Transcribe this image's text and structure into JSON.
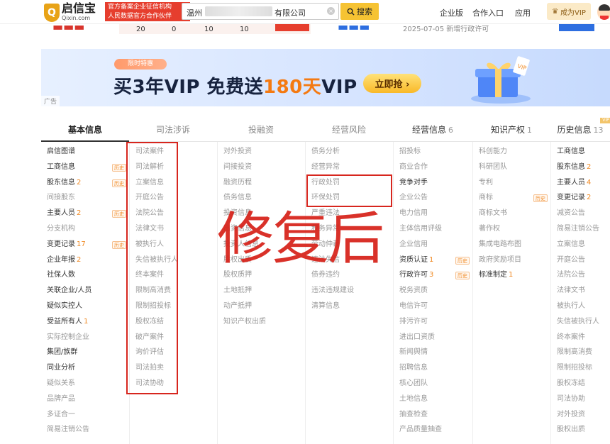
{
  "header": {
    "logo_cn": "启信宝",
    "logo_en": "Qixin.com",
    "badge_line1": "官方备案企业征信机构",
    "badge_line2": "人民数据官方合作伙伴",
    "search_value": "温州",
    "search_value_suffix": "有限公司",
    "search_button": "搜索",
    "nav": [
      "企业版",
      "合作入口",
      "应用"
    ],
    "vip_button": "成为VIP"
  },
  "strip": {
    "numbers": [
      "20",
      "0",
      "10",
      "10"
    ],
    "date": "2025-07-05 新增行政许可"
  },
  "banner": {
    "tag": "限时特惠",
    "text_a": "买3年VIP  免费送",
    "text_hl": "180天",
    "text_b": "VIP",
    "button": "立即抢 ›",
    "ad": "广告"
  },
  "tabs": [
    {
      "label": "基本信息",
      "count": ""
    },
    {
      "label": "司法涉诉",
      "count": ""
    },
    {
      "label": "投融资",
      "count": ""
    },
    {
      "label": "经营风险",
      "count": ""
    },
    {
      "label": "经营信息",
      "count": "6"
    },
    {
      "label": "知识产权",
      "count": "1"
    },
    {
      "label": "历史信息",
      "count": "13"
    }
  ],
  "vip_corner": "VIP",
  "history_tag": "历史",
  "columns": [
    [
      {
        "t": "启信图谱",
        "n": "",
        "h": false,
        "d": true
      },
      {
        "t": "工商信息",
        "n": "",
        "h": true,
        "d": true
      },
      {
        "t": "股东信息",
        "n": "2",
        "h": true,
        "d": true
      },
      {
        "t": "间接股东",
        "n": "",
        "h": false,
        "d": false
      },
      {
        "t": "主要人员",
        "n": "2",
        "h": true,
        "d": true
      },
      {
        "t": "分支机构",
        "n": "",
        "h": false,
        "d": false
      },
      {
        "t": "变更记录",
        "n": "17",
        "h": true,
        "d": true
      },
      {
        "t": "企业年报",
        "n": "2",
        "h": false,
        "d": true
      },
      {
        "t": "社保人数",
        "n": "",
        "h": false,
        "d": true
      },
      {
        "t": "关联企业/人员",
        "n": "",
        "h": false,
        "d": true
      },
      {
        "t": "疑似实控人",
        "n": "",
        "h": false,
        "d": true
      },
      {
        "t": "受益所有人",
        "n": "1",
        "h": false,
        "d": true
      },
      {
        "t": "实际控制企业",
        "n": "",
        "h": false,
        "d": false
      },
      {
        "t": "集团/族群",
        "n": "",
        "h": false,
        "d": true
      },
      {
        "t": "同业分析",
        "n": "",
        "h": false,
        "d": true
      },
      {
        "t": "疑似关系",
        "n": "",
        "h": false,
        "d": false
      },
      {
        "t": "品牌产品",
        "n": "",
        "h": false,
        "d": false
      },
      {
        "t": "多证合一",
        "n": "",
        "h": false,
        "d": false
      },
      {
        "t": "简易注销公告",
        "n": "",
        "h": false,
        "d": false
      }
    ],
    [
      {
        "t": "司法案件",
        "n": "",
        "h": false,
        "d": false
      },
      {
        "t": "司法解析",
        "n": "",
        "h": false,
        "d": false
      },
      {
        "t": "立案信息",
        "n": "",
        "h": false,
        "d": false
      },
      {
        "t": "开庭公告",
        "n": "",
        "h": false,
        "d": false
      },
      {
        "t": "法院公告",
        "n": "",
        "h": false,
        "d": false
      },
      {
        "t": "法律文书",
        "n": "",
        "h": false,
        "d": false
      },
      {
        "t": "被执行人",
        "n": "",
        "h": false,
        "d": false
      },
      {
        "t": "失信被执行人",
        "n": "",
        "h": false,
        "d": false
      },
      {
        "t": "终本案件",
        "n": "",
        "h": false,
        "d": false
      },
      {
        "t": "限制高消费",
        "n": "",
        "h": false,
        "d": false
      },
      {
        "t": "限制招投标",
        "n": "",
        "h": false,
        "d": false
      },
      {
        "t": "股权冻结",
        "n": "",
        "h": false,
        "d": false
      },
      {
        "t": "破产案件",
        "n": "",
        "h": false,
        "d": false
      },
      {
        "t": "询价评估",
        "n": "",
        "h": false,
        "d": false
      },
      {
        "t": "司法拍卖",
        "n": "",
        "h": false,
        "d": false
      },
      {
        "t": "司法协助",
        "n": "",
        "h": false,
        "d": false
      }
    ],
    [
      {
        "t": "对外投资",
        "n": "",
        "h": false,
        "d": false
      },
      {
        "t": "间接投资",
        "n": "",
        "h": false,
        "d": false
      },
      {
        "t": "融资历程",
        "n": "",
        "h": false,
        "d": false
      },
      {
        "t": "债务信息",
        "n": "",
        "h": false,
        "d": false
      },
      {
        "t": "投资信息",
        "n": "",
        "h": false,
        "d": false
      },
      {
        "t": "出资信息",
        "n": "",
        "h": false,
        "d": false
      },
      {
        "t": "投资人信息",
        "n": "",
        "h": false,
        "d": false
      },
      {
        "t": "股权出质",
        "n": "",
        "h": false,
        "d": false
      },
      {
        "t": "股权质押",
        "n": "",
        "h": false,
        "d": false
      },
      {
        "t": "土地抵押",
        "n": "",
        "h": false,
        "d": false
      },
      {
        "t": "动产抵押",
        "n": "",
        "h": false,
        "d": false
      },
      {
        "t": "知识产权出质",
        "n": "",
        "h": false,
        "d": false
      }
    ],
    [
      {
        "t": "债务分析",
        "n": "",
        "h": false,
        "d": false
      },
      {
        "t": "经营异常",
        "n": "",
        "h": false,
        "d": false
      },
      {
        "t": "行政处罚",
        "n": "",
        "h": false,
        "d": false
      },
      {
        "t": "环保处罚",
        "n": "",
        "h": false,
        "d": false
      },
      {
        "t": "严重违法",
        "n": "",
        "h": false,
        "d": false
      },
      {
        "t": "税务异常",
        "n": "",
        "h": false,
        "d": false
      },
      {
        "t": "劳动仲裁",
        "n": "",
        "h": false,
        "d": false
      },
      {
        "t": "违法失信",
        "n": "",
        "h": false,
        "d": false
      },
      {
        "t": "债券违约",
        "n": "",
        "h": false,
        "d": false
      },
      {
        "t": "违法违规建设",
        "n": "",
        "h": false,
        "d": false
      },
      {
        "t": "清算信息",
        "n": "",
        "h": false,
        "d": false
      }
    ],
    [
      {
        "t": "招投标",
        "n": "",
        "h": false,
        "d": false
      },
      {
        "t": "商业合作",
        "n": "",
        "h": false,
        "d": false
      },
      {
        "t": "竞争对手",
        "n": "",
        "h": false,
        "d": true
      },
      {
        "t": "企业公告",
        "n": "",
        "h": false,
        "d": false
      },
      {
        "t": "电力信用",
        "n": "",
        "h": false,
        "d": false
      },
      {
        "t": "主体信用评级",
        "n": "",
        "h": false,
        "d": false
      },
      {
        "t": "企业信用",
        "n": "",
        "h": false,
        "d": false
      },
      {
        "t": "资质认证",
        "n": "1",
        "h": true,
        "d": true
      },
      {
        "t": "行政许可",
        "n": "3",
        "h": true,
        "d": true
      },
      {
        "t": "税务资质",
        "n": "",
        "h": false,
        "d": false
      },
      {
        "t": "电信许可",
        "n": "",
        "h": false,
        "d": false
      },
      {
        "t": "排污许可",
        "n": "",
        "h": false,
        "d": false
      },
      {
        "t": "进出口资质",
        "n": "",
        "h": false,
        "d": false
      },
      {
        "t": "新闻舆情",
        "n": "",
        "h": false,
        "d": false
      },
      {
        "t": "招聘信息",
        "n": "",
        "h": false,
        "d": false
      },
      {
        "t": "核心团队",
        "n": "",
        "h": false,
        "d": false
      },
      {
        "t": "土地信息",
        "n": "",
        "h": false,
        "d": false
      },
      {
        "t": "抽查检查",
        "n": "",
        "h": false,
        "d": false
      },
      {
        "t": "产品质量抽查",
        "n": "",
        "h": false,
        "d": false
      }
    ],
    [
      {
        "t": "科创能力",
        "n": "",
        "h": false,
        "d": false
      },
      {
        "t": "科研团队",
        "n": "",
        "h": false,
        "d": false
      },
      {
        "t": "专利",
        "n": "",
        "h": false,
        "d": false
      },
      {
        "t": "商标",
        "n": "",
        "h": true,
        "d": false
      },
      {
        "t": "商标文书",
        "n": "",
        "h": false,
        "d": false
      },
      {
        "t": "著作权",
        "n": "",
        "h": false,
        "d": false
      },
      {
        "t": "集成电路布图",
        "n": "",
        "h": false,
        "d": false
      },
      {
        "t": "政府奖励项目",
        "n": "",
        "h": false,
        "d": false
      },
      {
        "t": "标准制定",
        "n": "1",
        "h": false,
        "d": true
      }
    ],
    [
      {
        "t": "工商信息",
        "n": "",
        "h": false,
        "d": true
      },
      {
        "t": "股东信息",
        "n": "2",
        "h": false,
        "d": true
      },
      {
        "t": "主要人员",
        "n": "4",
        "h": false,
        "d": true
      },
      {
        "t": "变更记录",
        "n": "2",
        "h": false,
        "d": true
      },
      {
        "t": "减资公告",
        "n": "",
        "h": false,
        "d": false
      },
      {
        "t": "简易注销公告",
        "n": "",
        "h": false,
        "d": false
      },
      {
        "t": "立案信息",
        "n": "",
        "h": false,
        "d": false
      },
      {
        "t": "开庭公告",
        "n": "",
        "h": false,
        "d": false
      },
      {
        "t": "法院公告",
        "n": "",
        "h": false,
        "d": false
      },
      {
        "t": "法律文书",
        "n": "",
        "h": false,
        "d": false
      },
      {
        "t": "被执行人",
        "n": "",
        "h": false,
        "d": false
      },
      {
        "t": "失信被执行人",
        "n": "",
        "h": false,
        "d": false
      },
      {
        "t": "终本案件",
        "n": "",
        "h": false,
        "d": false
      },
      {
        "t": "限制高消费",
        "n": "",
        "h": false,
        "d": false
      },
      {
        "t": "限制招投标",
        "n": "",
        "h": false,
        "d": false
      },
      {
        "t": "股权冻结",
        "n": "",
        "h": false,
        "d": false
      },
      {
        "t": "司法协助",
        "n": "",
        "h": false,
        "d": false
      },
      {
        "t": "对外投资",
        "n": "",
        "h": false,
        "d": false
      },
      {
        "t": "股权出质",
        "n": "",
        "h": false,
        "d": false
      }
    ]
  ],
  "annotation": {
    "text": "修复后"
  },
  "colors": {
    "accent": "#f6c333",
    "count": "#f08a24",
    "annotation": "#d7261e"
  }
}
